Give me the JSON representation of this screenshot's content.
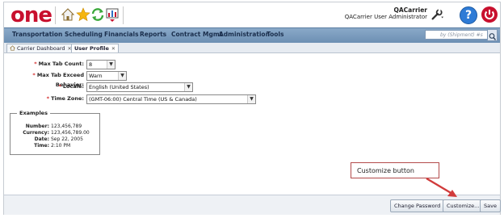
{
  "header": {
    "logo_text": "one",
    "company": "QACarrier",
    "user_role": "QACarrier User Administrator"
  },
  "nav": {
    "items": [
      "Transportation",
      "Scheduling",
      "Financials",
      "Reports",
      "Contract Mgmt",
      "Administration",
      "Tools"
    ],
    "search_placeholder": "by (Shipment) #s"
  },
  "tabs": [
    {
      "label": "Carrier Dashboard",
      "active": false
    },
    {
      "label": "User Profile",
      "active": true
    }
  ],
  "form": {
    "max_tab_count": {
      "label": "Max Tab Count:",
      "value": "8"
    },
    "max_tab_exceed": {
      "label": "Max Tab Exceed Behavior:",
      "value": "Warn"
    },
    "locale": {
      "label": "Locale:",
      "value": "English (United States)"
    },
    "time_zone": {
      "label": "Time Zone:",
      "value": "(GMT-06:00) Central Time (US & Canada)"
    }
  },
  "examples": {
    "title": "Examples",
    "rows": [
      {
        "k": "Number:",
        "v": "123,456,789"
      },
      {
        "k": "Currency:",
        "v": "123,456,789.00"
      },
      {
        "k": "Date:",
        "v": "Sep 22, 2005"
      },
      {
        "k": "Time:",
        "v": "2:10 PM"
      }
    ]
  },
  "callout": {
    "text": "Customize button"
  },
  "buttons": {
    "change_password": "Change Password",
    "customize": "Customize...",
    "save": "Save"
  },
  "colors": {
    "brand_red": "#c8102e",
    "nav_blue": "#6c8fb3",
    "callout_red": "#d13b3b"
  }
}
